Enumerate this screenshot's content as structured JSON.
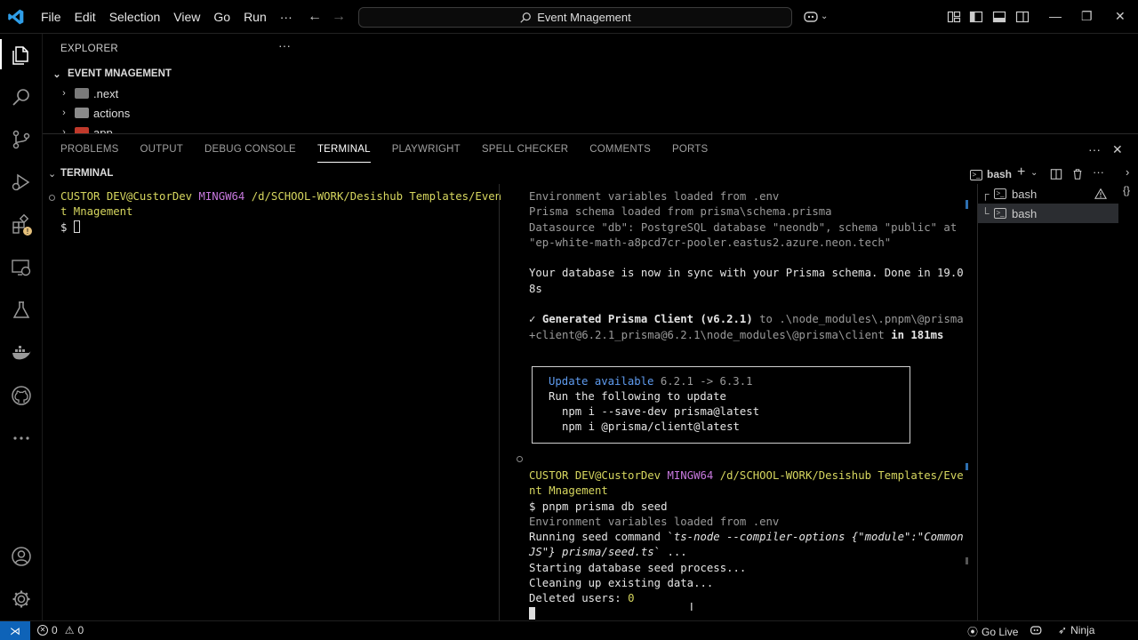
{
  "titlebar": {
    "menu": [
      "File",
      "Edit",
      "Selection",
      "View",
      "Go",
      "Run",
      "···"
    ],
    "search_text": "Event Mnagement",
    "back_arrow": "←",
    "forward_arrow": "→",
    "minimize": "—",
    "restore": "❐",
    "close": "✕"
  },
  "explorer": {
    "header": "EXPLORER",
    "more": "···",
    "root": "EVENT MNAGEMENT",
    "items": [
      ".next",
      "actions",
      "app"
    ]
  },
  "panel": {
    "tabs": [
      "PROBLEMS",
      "OUTPUT",
      "DEBUG CONSOLE",
      "TERMINAL",
      "PLAYWRIGHT",
      "SPELL CHECKER",
      "COMMENTS",
      "PORTS"
    ],
    "active_tab": "TERMINAL",
    "more": "···",
    "close": "✕"
  },
  "terminal": {
    "header": "TERMINAL",
    "shell_label": "bash",
    "add": "+",
    "more": "···",
    "list": [
      "bash",
      "bash"
    ]
  },
  "term_left": {
    "prompt_user": "CUSTOR DEV@CustorDev",
    "prompt_env": "MINGW64",
    "prompt_path_1": "/d/SCHOOL-WORK/Desishub Templates/Even",
    "prompt_path_2": "t Mnagement",
    "dollar": "$ "
  },
  "term_right": {
    "lines_top": [
      "Environment variables loaded from .env",
      "Prisma schema loaded from prisma\\schema.prisma",
      "Datasource \"db\": PostgreSQL database \"neondb\", schema \"public\" at",
      "\"ep-white-math-a8pcd7cr-pooler.eastus2.azure.neon.tech\""
    ],
    "sync_1": "Your database is now in sync with your Prisma schema. Done in 19.0",
    "sync_2": "8s",
    "generated_check": "✓",
    "generated_text": "Generated Prisma Client (v6.2.1)",
    "generated_to": "to",
    "generated_path_1": ".\\node_modules\\.pnpm\\@prisma",
    "generated_path_2": "+client@6.2.1_prisma@6.2.1\\node_modules\\@prisma\\client",
    "generated_time": "in 181ms",
    "update_label": "Update available",
    "update_versions": "6.2.1 -> 6.3.1",
    "update_run": "Run the following to update",
    "update_cmd_1": "npm i --save-dev prisma@latest",
    "update_cmd_2": "npm i @prisma/client@latest",
    "prompt_user": "CUSTOR DEV@CustorDev",
    "prompt_env": "MINGW64",
    "prompt_path_1": "/d/SCHOOL-WORK/Desishub Templates/Eve",
    "prompt_path_2": "nt Mnagement",
    "command": "$ pnpm prisma db seed",
    "env_loaded": "Environment variables loaded from .env",
    "seed_1_a": "Running seed command `",
    "seed_1_b": "ts-node --compiler-options {\"module\":\"Common",
    "seed_2_a": "JS\"} prisma/seed.ts",
    "seed_2_b": "` ...",
    "starting": "Starting database seed process...",
    "cleaning": "Cleaning up existing data...",
    "deleted_label": "Deleted users: ",
    "deleted_count": "0"
  },
  "statusbar": {
    "errors": "0",
    "warnings": "0",
    "go_live": "Go Live",
    "ninja": "Ninja"
  },
  "colors": {
    "accent": "#0e63b8",
    "prompt_yellow": "#d7d75f",
    "prompt_magenta": "#c678dd",
    "update_blue": "#5f9cf0",
    "warning": "#e5c07b"
  }
}
